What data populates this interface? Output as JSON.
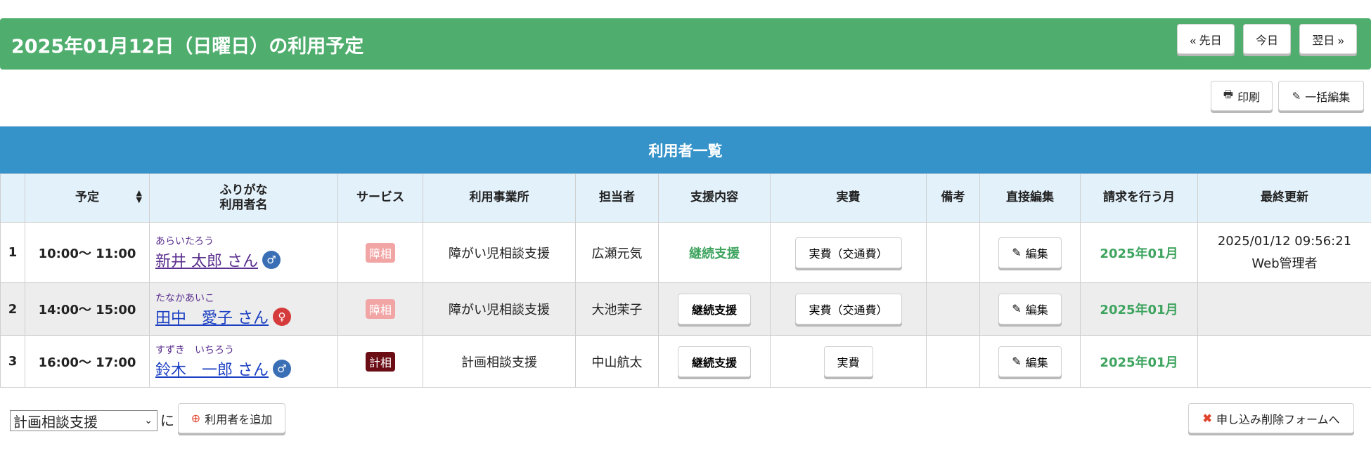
{
  "header": {
    "title": "2025年01月12日（日曜日）の利用予定",
    "prev_label": "« 先日",
    "today_label": "今日",
    "next_label": "翌日 »"
  },
  "toolbar": {
    "print_label": "印刷",
    "bulk_edit_label": "一括編集"
  },
  "list": {
    "title": "利用者一覧",
    "columns": {
      "schedule": "予定",
      "name_top": "ふりがな",
      "name_bottom": "利用者名",
      "service": "サービス",
      "office": "利用事業所",
      "staff": "担当者",
      "support": "支援内容",
      "expense": "実費",
      "note": "備考",
      "direct_edit": "直接編集",
      "billing_month": "請求を行う月",
      "last_update": "最終更新"
    },
    "rows": [
      {
        "num": "1",
        "time": "10:00～ 11:00",
        "kana": "あらいたろう",
        "name": "新井 太郎 さん",
        "service": "障相",
        "office": "障がい児相談支援",
        "staff": "広瀬元気",
        "support": "継続支援",
        "expense": "実費（交通費）",
        "edit": "編集",
        "billing": "2025年01月",
        "updated_at": "2025/01/12 09:56:21",
        "updated_by": "Web管理者"
      },
      {
        "num": "2",
        "time": "14:00～ 15:00",
        "kana": "たなかあいこ",
        "name": "田中　愛子 さん",
        "service": "障相",
        "office": "障がい児相談支援",
        "staff": "大池茉子",
        "support": "継続支援",
        "expense": "実費（交通費）",
        "edit": "編集",
        "billing": "2025年01月"
      },
      {
        "num": "3",
        "time": "16:00～ 17:00",
        "kana": "すずき　いちろう",
        "name": "鈴木　一郎 さん",
        "service": "計相",
        "office": "計画相談支援",
        "staff": "中山航太",
        "support": "継続支援",
        "expense": "実費",
        "edit": "編集",
        "billing": "2025年01月"
      }
    ]
  },
  "footer": {
    "select_value": "計画相談支援",
    "suffix": "に",
    "add_user_label": "利用者を追加",
    "delete_form_label": "申し込み削除フォームへ"
  },
  "colors": {
    "header_green": "#4fae6e",
    "list_blue": "#3593c9",
    "accent_green_text": "#3ea45f"
  },
  "icons": {
    "print": "printer-icon",
    "edit": "edit-icon",
    "sort": "sort-icon",
    "male": "male-user-icon",
    "female": "female-user-icon",
    "add": "plus-circle-icon",
    "delete": "close-icon"
  }
}
